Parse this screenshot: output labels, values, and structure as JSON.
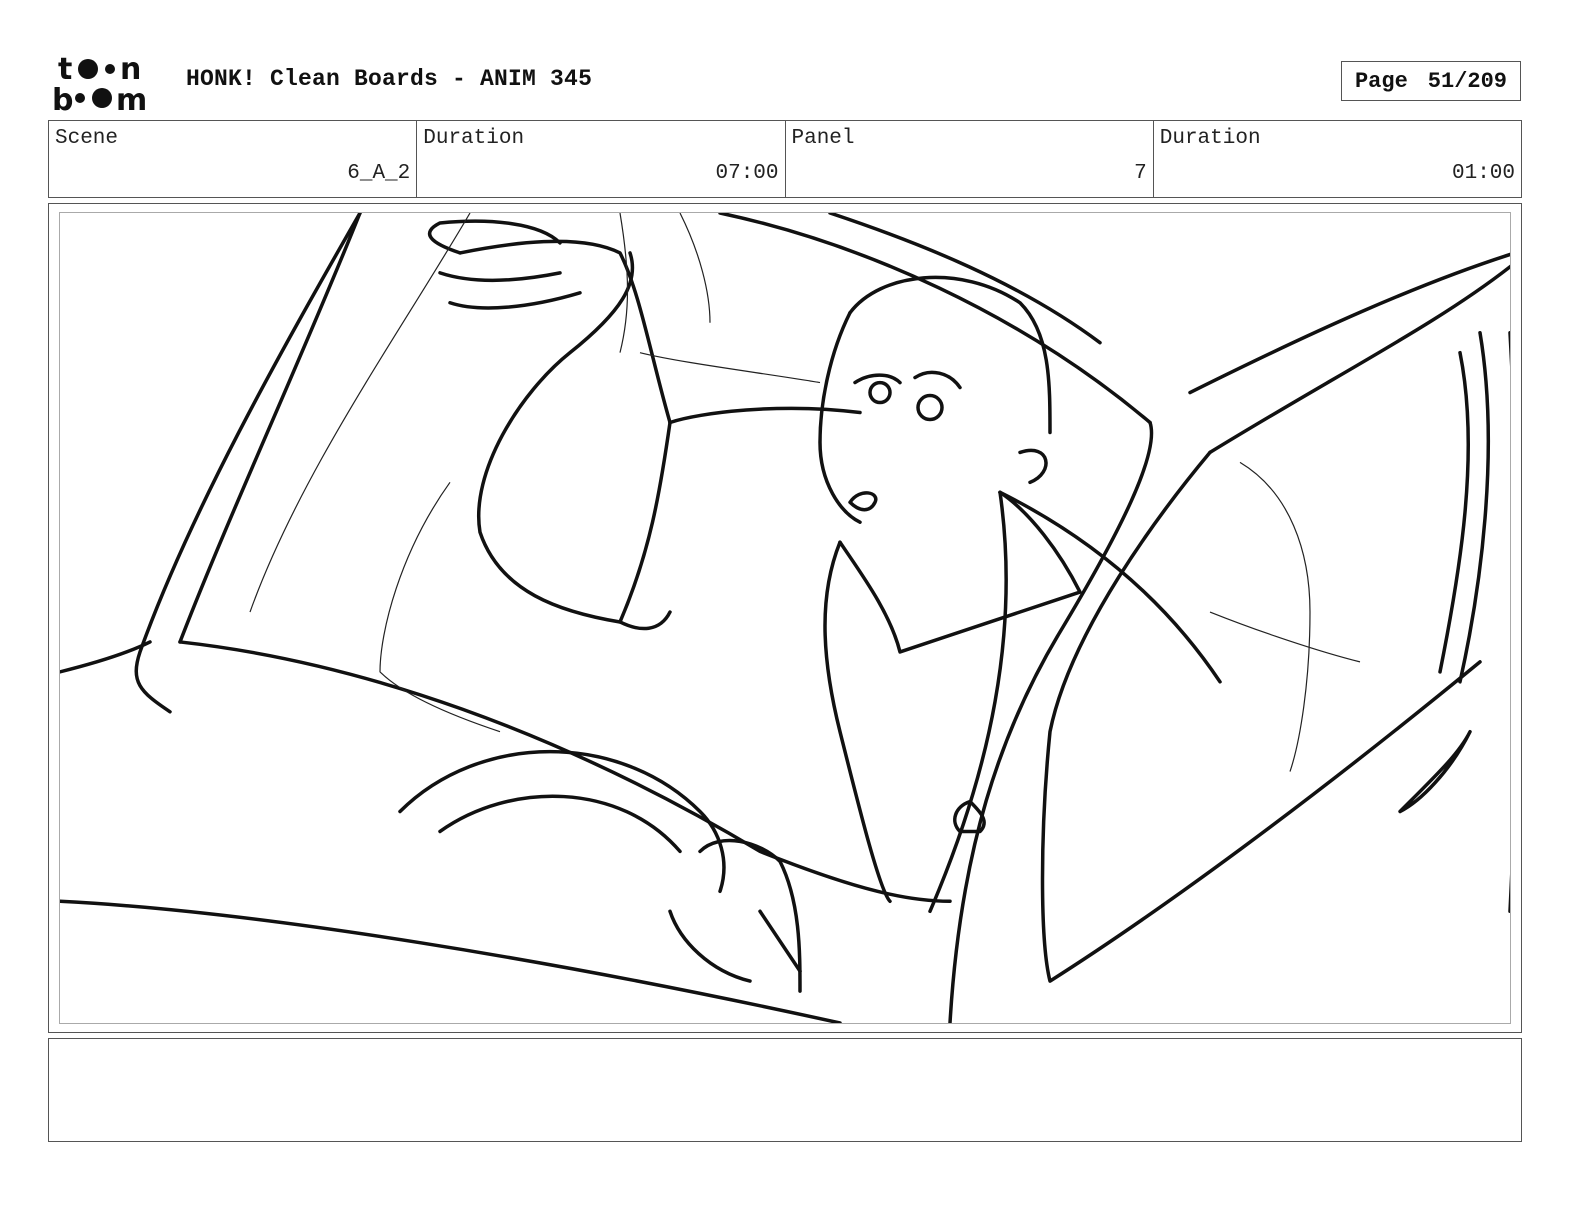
{
  "header": {
    "title": "HONK! Clean Boards - ANIM 345",
    "page_label": "Page",
    "page_number": "51/209"
  },
  "logo": {
    "icon": "toonboom-logo"
  },
  "info": {
    "scene_label": "Scene",
    "scene_value": "6_A_2",
    "scene_duration_label": "Duration",
    "scene_duration_value": "07:00",
    "panel_label": "Panel",
    "panel_value": "7",
    "panel_duration_label": "Duration",
    "panel_duration_value": "01:00"
  },
  "panel": {
    "image": "storyboard-drawing-driver-in-car"
  },
  "notes": {
    "text": ""
  }
}
